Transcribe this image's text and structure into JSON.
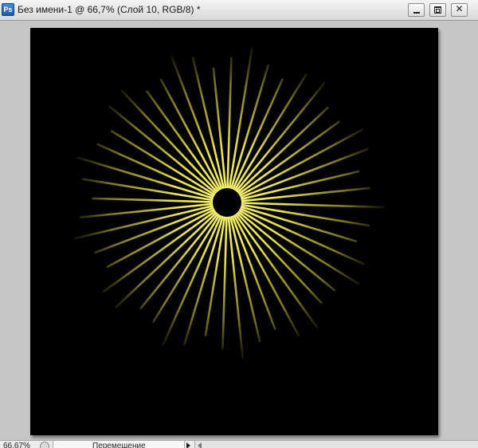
{
  "window": {
    "app_icon": "Ps",
    "title": "Без имени-1 @ 66,7% (Слой 10, RGB/8) *",
    "controls": {
      "minimize_icon": "minimize-icon",
      "maximize_icon": "restore-icon",
      "close_icon": "close-icon",
      "close_glyph": "✕"
    }
  },
  "canvas": {
    "background_color": "#000000",
    "artwork": {
      "description_icon": "sunburst",
      "ray_color": "#f5ee55",
      "ray_count": 48,
      "center_color": "#000000"
    }
  },
  "statusbar": {
    "zoom": "66,67%",
    "tool_label": "Перемещение"
  }
}
